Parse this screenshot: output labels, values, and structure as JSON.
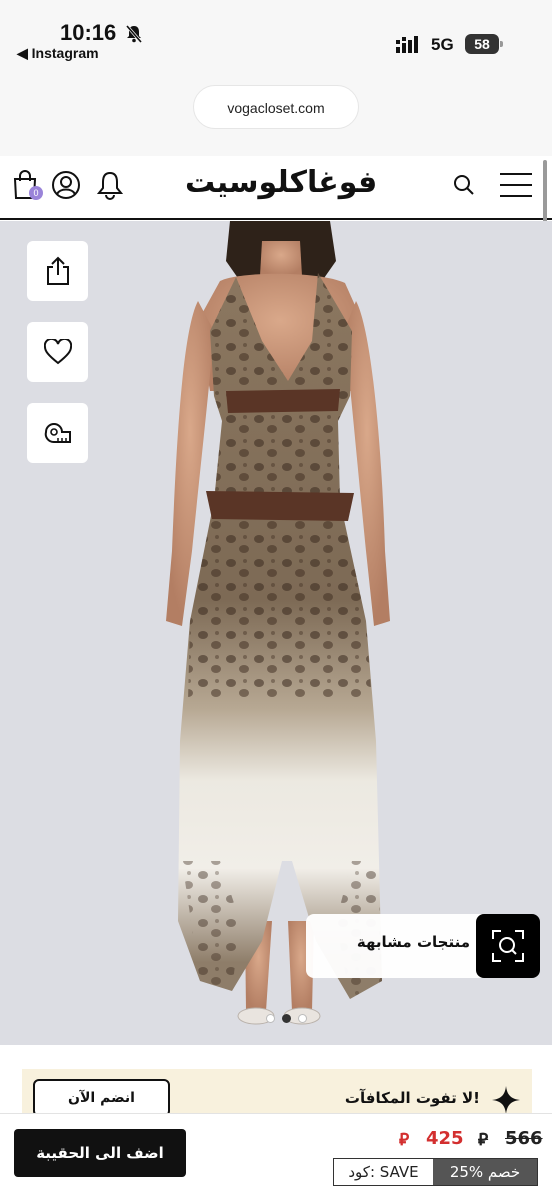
{
  "status_bar": {
    "time": "10:16",
    "back_app": "◀ Instagram",
    "network": "5G",
    "battery": "58"
  },
  "browser": {
    "url": "vogacloset.com"
  },
  "header": {
    "brand": "فوغاكلوسيت",
    "cart_count": "0"
  },
  "product": {
    "image_description": "model wearing leopard print halter maxi dress",
    "similar_products_label": "منتجات مشابهة",
    "carousel_dots": 3
  },
  "rewards": {
    "text": "لا تفوت المكافآت!",
    "join_label": "انضم الآن"
  },
  "purchase": {
    "add_to_bag_label": "اضف الى الحقيبة",
    "old_price": "566",
    "new_price": "425",
    "currency_symbol": "⃁",
    "discount_label": "25% خصم",
    "coupon_label": "كود: SAVE"
  },
  "colors": {
    "accent_purple": "#9a84d9",
    "price_red": "#d32f2f",
    "rewards_bg": "#f8f1dd",
    "product_bg": "#dcdde3"
  }
}
